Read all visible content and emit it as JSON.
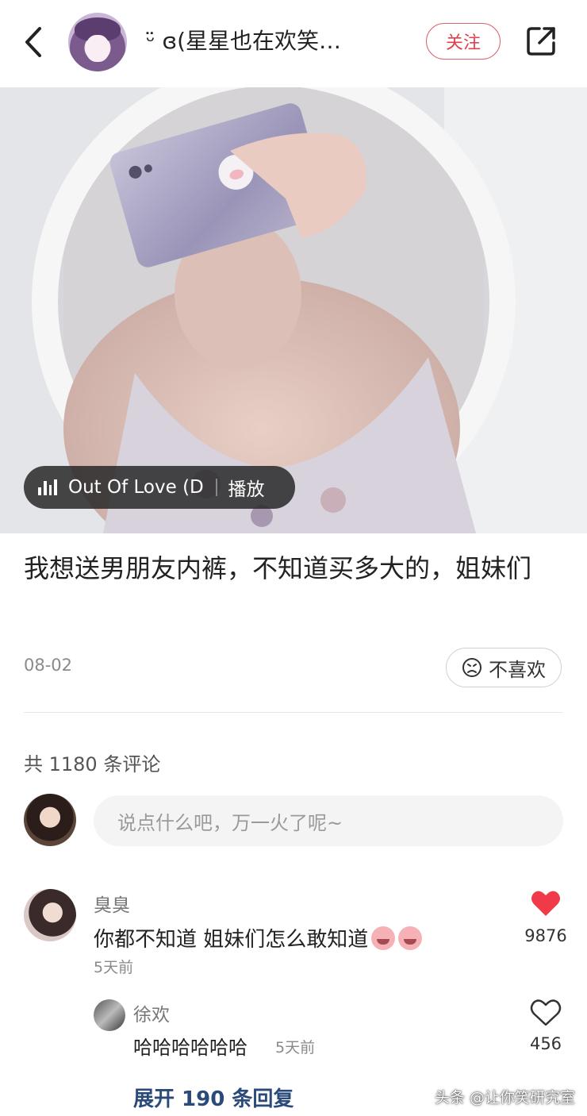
{
  "header": {
    "username": "ᵕ̈ ɞ(星星也在欢笑…",
    "follow_label": "关注"
  },
  "media": {
    "song_title": "Out Of Love (Deva",
    "play_label": "播放"
  },
  "post": {
    "title": "我想送男朋友内裤，不知道买多大的，姐妹们",
    "date": "08-02",
    "dislike_label": "不喜欢"
  },
  "comments_section": {
    "count_text": "共 1180 条评论",
    "input_placeholder": "说点什么吧，万一火了呢~"
  },
  "comments": [
    {
      "name": "臭臭",
      "text": "你都不知道 姐妹们怎么敢知道",
      "time": "5天前",
      "likes": "9876",
      "liked": true,
      "reply": {
        "name": "徐欢",
        "text": "哈哈哈哈哈哈",
        "time": "5天前",
        "likes": "456",
        "liked": false
      },
      "expand_label": "展开 190 条回复"
    }
  ],
  "watermark": "头条 @让你笑研究室",
  "colors": {
    "accent": "#e0414f",
    "link": "#2a4a7a",
    "like_red": "#f03a4a"
  }
}
